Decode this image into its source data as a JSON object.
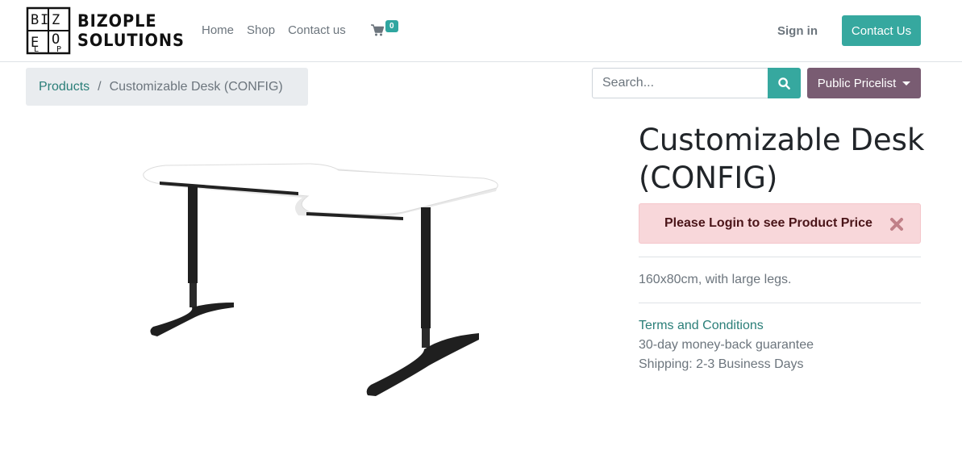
{
  "header": {
    "brand_line1": "BIZOPLE",
    "brand_line2": "SOLUTIONS",
    "nav": [
      "Home",
      "Shop",
      "Contact us"
    ],
    "cart_count": "0",
    "cart_icon": "shopping-cart-icon",
    "sign_in": "Sign in",
    "contact_button": "Contact Us"
  },
  "breadcrumb": {
    "link": "Products",
    "separator": "/",
    "current": "Customizable Desk (CONFIG)"
  },
  "search": {
    "placeholder": "Search...",
    "icon": "search-icon"
  },
  "pricelist": {
    "label": "Public Pricelist"
  },
  "product": {
    "title": "Customizable Desk (CONFIG)",
    "alert": "Please Login to see Product Price",
    "description": "160x80cm, with large legs.",
    "terms": "Terms and Conditions",
    "guarantee": "30-day money-back guarantee",
    "shipping": "Shipping: 2-3 Business Days"
  },
  "colors": {
    "accent": "#36a89f",
    "pricelist": "#795c72",
    "alert_bg": "#f8d7da",
    "link": "#2a7e78"
  }
}
